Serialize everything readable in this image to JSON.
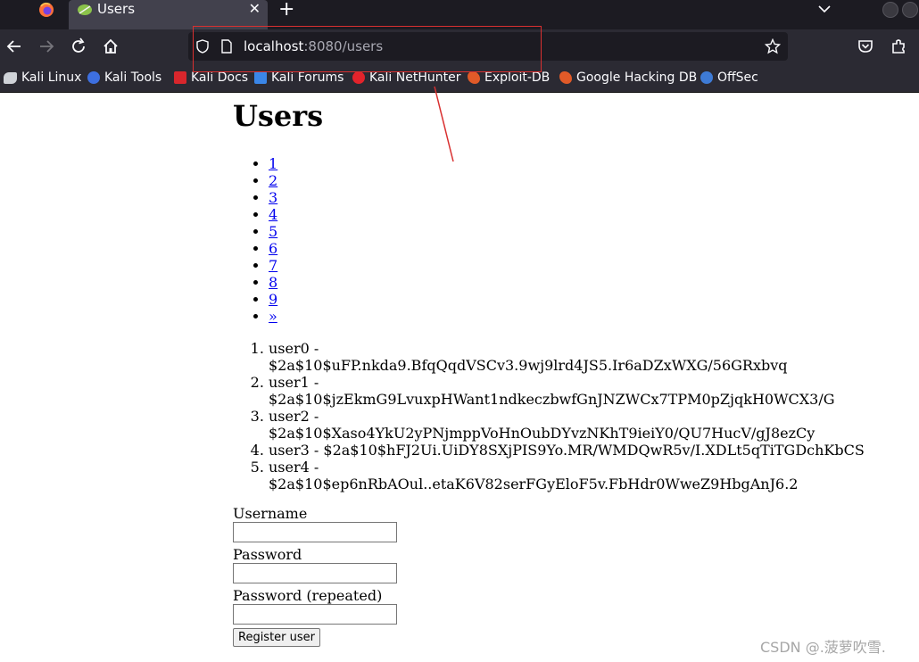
{
  "tab": {
    "title": "Users"
  },
  "address_bar": {
    "host": "localhost",
    "rest": ":8080/users"
  },
  "bookmarks": [
    {
      "label": "Kali Linux",
      "icon": "kali-dragon-icon"
    },
    {
      "label": "Kali Tools",
      "icon": "kali-tools-icon"
    },
    {
      "label": "Kali Docs",
      "icon": "kali-docs-icon"
    },
    {
      "label": "Kali Forums",
      "icon": "kali-forums-icon"
    },
    {
      "label": "Kali NetHunter",
      "icon": "kali-nethunter-icon"
    },
    {
      "label": "Exploit-DB",
      "icon": "exploit-db-icon"
    },
    {
      "label": "Google Hacking DB",
      "icon": "exploit-db-icon"
    },
    {
      "label": "OffSec",
      "icon": "offsec-icon"
    }
  ],
  "page": {
    "title": "Users",
    "pages": [
      "1",
      "2",
      "3",
      "4",
      "5",
      "6",
      "7",
      "8",
      "9",
      "»"
    ],
    "users": [
      {
        "name": "user0 -",
        "hash": "$2a$10$uFP.nkda9.BfqQqdVSCv3.9wj9lrd4JS5.Ir6aDZxWXG/56GRxbvq"
      },
      {
        "name": "user1 -",
        "hash": "$2a$10$jzEkmG9LvuxpHWant1ndkeczbwfGnJNZWCx7TPM0pZjqkH0WCX3/G"
      },
      {
        "name": "user2 -",
        "hash": "$2a$10$Xaso4YkU2yPNjmppVoHnOubDYvzNKhT9ieiY0/QU7HucV/gJ8ezCy"
      },
      {
        "name": "user3 -",
        "hash": "$2a$10$hFJ2Ui.UiDY8SXjPIS9Yo.MR/WMDQwR5v/I.XDLt5qTiTGDchKbCS"
      },
      {
        "name": "user4 -",
        "hash": "$2a$10$ep6nRbAOul..etaK6V82serFGyEloF5v.FbHdr0WweZ9HbgAnJ6.2"
      }
    ],
    "form": {
      "username_label": "Username",
      "password_label": "Password",
      "password_repeat_label": "Password (repeated)",
      "submit_label": "Register user"
    }
  },
  "watermark": "CSDN @.菠萝吹雪.",
  "colors": {
    "annotation": "#d93030",
    "link": "#0000ee",
    "chrome_dark": "#1c1b22",
    "chrome": "#2b2a33"
  }
}
